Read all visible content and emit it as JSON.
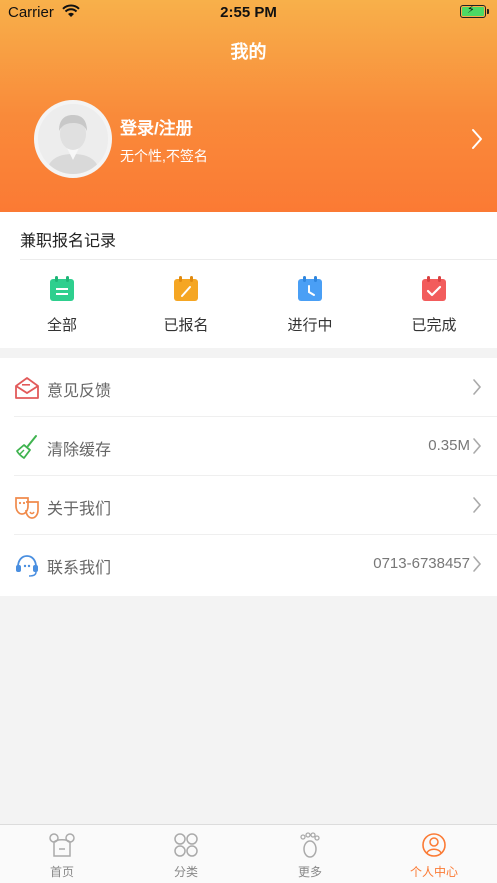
{
  "status_bar": {
    "carrier": "Carrier",
    "time": "2:55 PM"
  },
  "header": {
    "title": "我的",
    "login_label": "登录/注册",
    "signature": "无个性,不签名"
  },
  "records": {
    "title": "兼职报名记录",
    "items": [
      {
        "label": "全部",
        "icon": "calendar-list-icon",
        "color": "#2ecf8e"
      },
      {
        "label": "已报名",
        "icon": "calendar-edit-icon",
        "color": "#f5a623"
      },
      {
        "label": "进行中",
        "icon": "calendar-clock-icon",
        "color": "#4a9ff5"
      },
      {
        "label": "已完成",
        "icon": "calendar-check-icon",
        "color": "#f25c5c"
      }
    ]
  },
  "menu": {
    "items": [
      {
        "label": "意见反馈",
        "value": "",
        "icon": "envelope-icon"
      },
      {
        "label": "清除缓存",
        "value": "0.35M",
        "icon": "broom-icon"
      },
      {
        "label": "关于我们",
        "value": "",
        "icon": "masks-icon"
      },
      {
        "label": "联系我们",
        "value": "0713-6738457",
        "icon": "headset-icon"
      }
    ]
  },
  "tabbar": {
    "items": [
      {
        "label": "首页",
        "icon": "home-bear-icon",
        "active": false
      },
      {
        "label": "分类",
        "icon": "grid-circles-icon",
        "active": false
      },
      {
        "label": "更多",
        "icon": "footprint-icon",
        "active": false
      },
      {
        "label": "个人中心",
        "icon": "person-icon",
        "active": true
      }
    ]
  },
  "colors": {
    "header_gradient_top": "#f8b04a",
    "header_gradient_bottom": "#fb7a34",
    "accent": "#fb7a34"
  }
}
